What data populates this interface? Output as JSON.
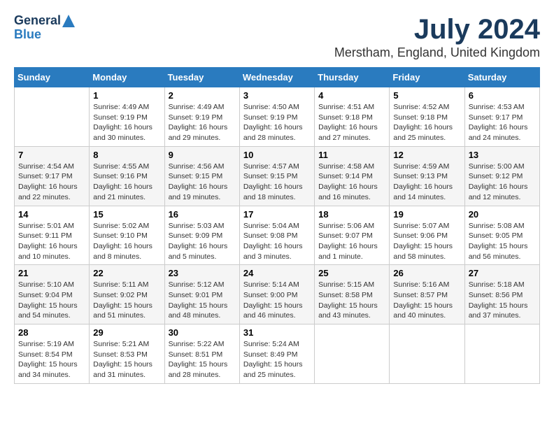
{
  "logo": {
    "line1": "General",
    "line2": "Blue"
  },
  "title": "July 2024",
  "subtitle": "Merstham, England, United Kingdom",
  "days_of_week": [
    "Sunday",
    "Monday",
    "Tuesday",
    "Wednesday",
    "Thursday",
    "Friday",
    "Saturday"
  ],
  "weeks": [
    [
      {
        "num": "",
        "sunrise": "",
        "sunset": "",
        "daylight": ""
      },
      {
        "num": "1",
        "sunrise": "Sunrise: 4:49 AM",
        "sunset": "Sunset: 9:19 PM",
        "daylight": "Daylight: 16 hours and 30 minutes."
      },
      {
        "num": "2",
        "sunrise": "Sunrise: 4:49 AM",
        "sunset": "Sunset: 9:19 PM",
        "daylight": "Daylight: 16 hours and 29 minutes."
      },
      {
        "num": "3",
        "sunrise": "Sunrise: 4:50 AM",
        "sunset": "Sunset: 9:19 PM",
        "daylight": "Daylight: 16 hours and 28 minutes."
      },
      {
        "num": "4",
        "sunrise": "Sunrise: 4:51 AM",
        "sunset": "Sunset: 9:18 PM",
        "daylight": "Daylight: 16 hours and 27 minutes."
      },
      {
        "num": "5",
        "sunrise": "Sunrise: 4:52 AM",
        "sunset": "Sunset: 9:18 PM",
        "daylight": "Daylight: 16 hours and 25 minutes."
      },
      {
        "num": "6",
        "sunrise": "Sunrise: 4:53 AM",
        "sunset": "Sunset: 9:17 PM",
        "daylight": "Daylight: 16 hours and 24 minutes."
      }
    ],
    [
      {
        "num": "7",
        "sunrise": "Sunrise: 4:54 AM",
        "sunset": "Sunset: 9:17 PM",
        "daylight": "Daylight: 16 hours and 22 minutes."
      },
      {
        "num": "8",
        "sunrise": "Sunrise: 4:55 AM",
        "sunset": "Sunset: 9:16 PM",
        "daylight": "Daylight: 16 hours and 21 minutes."
      },
      {
        "num": "9",
        "sunrise": "Sunrise: 4:56 AM",
        "sunset": "Sunset: 9:15 PM",
        "daylight": "Daylight: 16 hours and 19 minutes."
      },
      {
        "num": "10",
        "sunrise": "Sunrise: 4:57 AM",
        "sunset": "Sunset: 9:15 PM",
        "daylight": "Daylight: 16 hours and 18 minutes."
      },
      {
        "num": "11",
        "sunrise": "Sunrise: 4:58 AM",
        "sunset": "Sunset: 9:14 PM",
        "daylight": "Daylight: 16 hours and 16 minutes."
      },
      {
        "num": "12",
        "sunrise": "Sunrise: 4:59 AM",
        "sunset": "Sunset: 9:13 PM",
        "daylight": "Daylight: 16 hours and 14 minutes."
      },
      {
        "num": "13",
        "sunrise": "Sunrise: 5:00 AM",
        "sunset": "Sunset: 9:12 PM",
        "daylight": "Daylight: 16 hours and 12 minutes."
      }
    ],
    [
      {
        "num": "14",
        "sunrise": "Sunrise: 5:01 AM",
        "sunset": "Sunset: 9:11 PM",
        "daylight": "Daylight: 16 hours and 10 minutes."
      },
      {
        "num": "15",
        "sunrise": "Sunrise: 5:02 AM",
        "sunset": "Sunset: 9:10 PM",
        "daylight": "Daylight: 16 hours and 8 minutes."
      },
      {
        "num": "16",
        "sunrise": "Sunrise: 5:03 AM",
        "sunset": "Sunset: 9:09 PM",
        "daylight": "Daylight: 16 hours and 5 minutes."
      },
      {
        "num": "17",
        "sunrise": "Sunrise: 5:04 AM",
        "sunset": "Sunset: 9:08 PM",
        "daylight": "Daylight: 16 hours and 3 minutes."
      },
      {
        "num": "18",
        "sunrise": "Sunrise: 5:06 AM",
        "sunset": "Sunset: 9:07 PM",
        "daylight": "Daylight: 16 hours and 1 minute."
      },
      {
        "num": "19",
        "sunrise": "Sunrise: 5:07 AM",
        "sunset": "Sunset: 9:06 PM",
        "daylight": "Daylight: 15 hours and 58 minutes."
      },
      {
        "num": "20",
        "sunrise": "Sunrise: 5:08 AM",
        "sunset": "Sunset: 9:05 PM",
        "daylight": "Daylight: 15 hours and 56 minutes."
      }
    ],
    [
      {
        "num": "21",
        "sunrise": "Sunrise: 5:10 AM",
        "sunset": "Sunset: 9:04 PM",
        "daylight": "Daylight: 15 hours and 54 minutes."
      },
      {
        "num": "22",
        "sunrise": "Sunrise: 5:11 AM",
        "sunset": "Sunset: 9:02 PM",
        "daylight": "Daylight: 15 hours and 51 minutes."
      },
      {
        "num": "23",
        "sunrise": "Sunrise: 5:12 AM",
        "sunset": "Sunset: 9:01 PM",
        "daylight": "Daylight: 15 hours and 48 minutes."
      },
      {
        "num": "24",
        "sunrise": "Sunrise: 5:14 AM",
        "sunset": "Sunset: 9:00 PM",
        "daylight": "Daylight: 15 hours and 46 minutes."
      },
      {
        "num": "25",
        "sunrise": "Sunrise: 5:15 AM",
        "sunset": "Sunset: 8:58 PM",
        "daylight": "Daylight: 15 hours and 43 minutes."
      },
      {
        "num": "26",
        "sunrise": "Sunrise: 5:16 AM",
        "sunset": "Sunset: 8:57 PM",
        "daylight": "Daylight: 15 hours and 40 minutes."
      },
      {
        "num": "27",
        "sunrise": "Sunrise: 5:18 AM",
        "sunset": "Sunset: 8:56 PM",
        "daylight": "Daylight: 15 hours and 37 minutes."
      }
    ],
    [
      {
        "num": "28",
        "sunrise": "Sunrise: 5:19 AM",
        "sunset": "Sunset: 8:54 PM",
        "daylight": "Daylight: 15 hours and 34 minutes."
      },
      {
        "num": "29",
        "sunrise": "Sunrise: 5:21 AM",
        "sunset": "Sunset: 8:53 PM",
        "daylight": "Daylight: 15 hours and 31 minutes."
      },
      {
        "num": "30",
        "sunrise": "Sunrise: 5:22 AM",
        "sunset": "Sunset: 8:51 PM",
        "daylight": "Daylight: 15 hours and 28 minutes."
      },
      {
        "num": "31",
        "sunrise": "Sunrise: 5:24 AM",
        "sunset": "Sunset: 8:49 PM",
        "daylight": "Daylight: 15 hours and 25 minutes."
      },
      {
        "num": "",
        "sunrise": "",
        "sunset": "",
        "daylight": ""
      },
      {
        "num": "",
        "sunrise": "",
        "sunset": "",
        "daylight": ""
      },
      {
        "num": "",
        "sunrise": "",
        "sunset": "",
        "daylight": ""
      }
    ]
  ]
}
